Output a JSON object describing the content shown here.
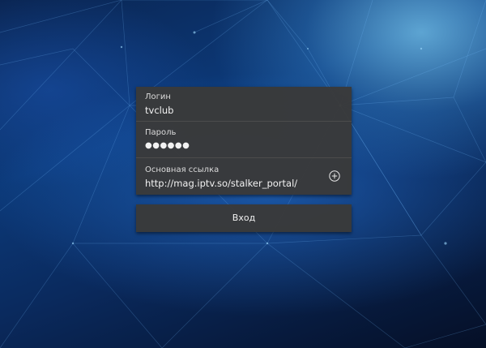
{
  "form": {
    "login": {
      "label": "Логин",
      "value": "tvclub"
    },
    "password": {
      "label": "Пароль",
      "value": "●●●●●●"
    },
    "portal": {
      "label": "Основная ссылка",
      "value": "http://mag.iptv.so/stalker_portal/",
      "action_icon": "plus-circle-icon"
    }
  },
  "login_button": {
    "label": "Вход"
  },
  "colors": {
    "panel": "#3a3a3a",
    "text": "#f2f2f2",
    "background": "#0a2a5e"
  }
}
